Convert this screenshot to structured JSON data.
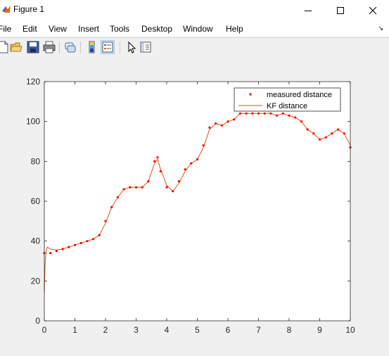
{
  "window": {
    "title": "Figure 1"
  },
  "menu": [
    "File",
    "Edit",
    "View",
    "Insert",
    "Tools",
    "Desktop",
    "Window",
    "Help"
  ],
  "icons": [
    "matlab-logo-icon",
    "new-figure-icon",
    "open-file-icon",
    "save-icon",
    "print-icon",
    "link-icon",
    "colorbar-icon",
    "legend-icon",
    "pointer-icon",
    "property-editor-icon"
  ],
  "chart_data": {
    "type": "line",
    "title": "",
    "xlabel": "",
    "ylabel": "",
    "xlim": [
      0,
      10
    ],
    "ylim": [
      0,
      120
    ],
    "xticks": [
      0,
      1,
      2,
      3,
      4,
      5,
      6,
      7,
      8,
      9,
      10
    ],
    "yticks": [
      0,
      20,
      40,
      60,
      80,
      100,
      120
    ],
    "grid": false,
    "legend": {
      "position": "top-right"
    },
    "series": [
      {
        "name": "measured distance",
        "style": "markers",
        "color": "#ff0000",
        "x": [
          0.0,
          0.2,
          0.4,
          0.6,
          0.8,
          1.0,
          1.2,
          1.4,
          1.6,
          1.8,
          2.0,
          2.2,
          2.4,
          2.6,
          2.8,
          3.0,
          3.2,
          3.4,
          3.6,
          3.7,
          3.8,
          4.0,
          4.2,
          4.4,
          4.6,
          4.8,
          5.0,
          5.2,
          5.4,
          5.6,
          5.8,
          6.0,
          6.2,
          6.4,
          6.6,
          6.8,
          7.0,
          7.2,
          7.4,
          7.6,
          7.8,
          8.0,
          8.2,
          8.4,
          8.6,
          8.8,
          9.0,
          9.2,
          9.4,
          9.6,
          9.8,
          10.0
        ],
        "y": [
          34,
          34,
          35,
          36,
          37,
          38,
          39,
          40,
          41,
          43,
          50,
          57,
          62,
          66,
          67,
          67,
          67,
          70,
          80,
          82,
          75,
          67,
          65,
          70,
          76,
          79,
          81,
          88,
          97,
          99,
          98,
          100,
          101,
          104,
          104,
          104,
          104,
          104,
          104,
          103,
          104,
          103,
          102,
          100,
          96,
          94,
          91,
          92,
          94,
          96,
          94,
          87
        ]
      },
      {
        "name": "KF distance",
        "style": "line",
        "color": "#d95319",
        "x": [
          0.0,
          0.03,
          0.06,
          0.1,
          0.2,
          0.4,
          0.6,
          0.8,
          1.0,
          1.2,
          1.4,
          1.6,
          1.8,
          2.0,
          2.2,
          2.4,
          2.6,
          2.8,
          3.0,
          3.2,
          3.4,
          3.6,
          3.7,
          3.8,
          4.0,
          4.2,
          4.4,
          4.6,
          4.8,
          5.0,
          5.2,
          5.4,
          5.6,
          5.8,
          6.0,
          6.2,
          6.4,
          6.6,
          6.8,
          7.0,
          7.2,
          7.4,
          7.6,
          7.8,
          8.0,
          8.2,
          8.4,
          8.6,
          8.8,
          9.0,
          9.2,
          9.4,
          9.6,
          9.8,
          10.0
        ],
        "y": [
          14,
          30,
          35,
          37,
          36,
          35.5,
          36,
          37,
          38,
          39,
          40,
          41,
          43,
          49,
          57,
          62,
          66,
          67,
          67,
          67,
          70,
          79,
          81,
          76,
          68,
          65,
          69,
          75,
          79,
          81,
          87,
          96,
          99,
          98,
          100,
          101,
          104,
          104,
          104,
          104,
          104,
          104,
          103,
          104,
          103,
          102,
          100,
          96,
          94,
          91,
          92,
          94,
          96,
          94,
          88
        ]
      }
    ]
  }
}
